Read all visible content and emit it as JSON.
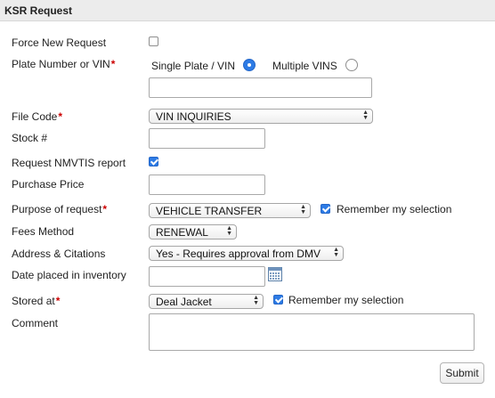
{
  "panel": {
    "title": "KSR Request"
  },
  "fields": {
    "force_new": {
      "label": "Force New Request",
      "checked": false
    },
    "plate": {
      "label": "Plate Number or VIN",
      "required_mark": "*",
      "option_single": "Single Plate / VIN",
      "option_multiple": "Multiple VINS",
      "selected": "single",
      "value": ""
    },
    "file_code": {
      "label": "File Code",
      "required_mark": "*",
      "selected": "VIN INQUIRIES"
    },
    "stock": {
      "label": "Stock #",
      "value": ""
    },
    "nmvtis": {
      "label": "Request NMVTIS report",
      "checked": true
    },
    "purchase_price": {
      "label": "Purchase Price",
      "value": ""
    },
    "purpose": {
      "label": "Purpose of request",
      "required_mark": "*",
      "selected": "VEHICLE TRANSFER",
      "remember_label": "Remember my selection",
      "remember_checked": true
    },
    "fees": {
      "label": "Fees Method",
      "selected": "RENEWAL"
    },
    "address": {
      "label": "Address & Citations",
      "selected": "Yes - Requires approval from DMV"
    },
    "date_inventory": {
      "label": "Date placed in inventory",
      "value": ""
    },
    "stored_at": {
      "label": "Stored at",
      "required_mark": "*",
      "selected": "Deal Jacket",
      "remember_label": "Remember my selection",
      "remember_checked": true
    },
    "comment": {
      "label": "Comment",
      "value": ""
    }
  },
  "actions": {
    "submit_label": "Submit"
  },
  "colors": {
    "accent": "#2d7be5",
    "required": "#cc0000",
    "header_bg": "#ececec"
  }
}
